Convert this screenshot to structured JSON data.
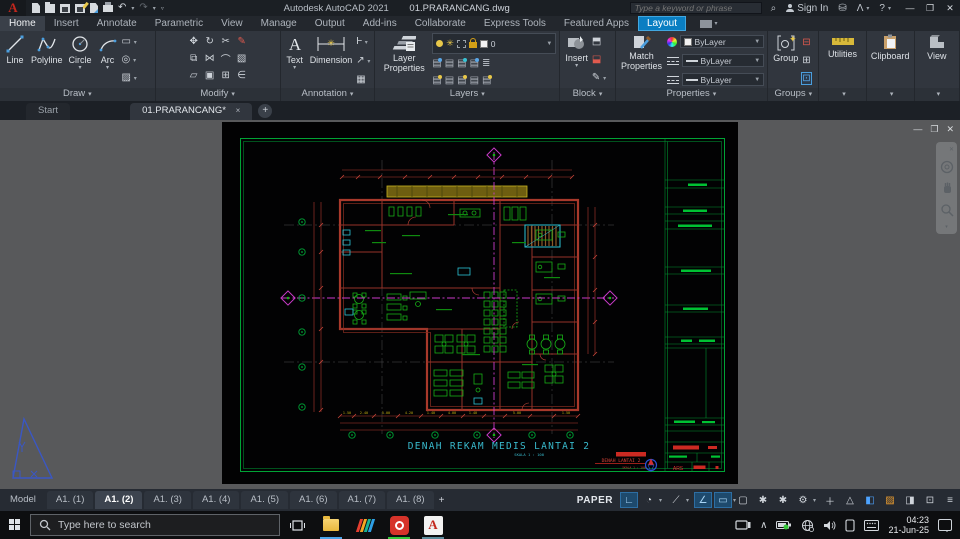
{
  "titlebar": {
    "app": "Autodesk AutoCAD 2021",
    "doc": "01.PRARANCANG.dwg",
    "search_placeholder": "Type a keyword or phrase",
    "sign_in": "Sign In"
  },
  "ribbon": {
    "tabs": [
      "Home",
      "Insert",
      "Annotate",
      "Parametric",
      "View",
      "Manage",
      "Output",
      "Add-ins",
      "Collaborate",
      "Express Tools",
      "Featured Apps",
      "Layout"
    ],
    "draw": {
      "label": "Draw",
      "line": "Line",
      "polyline": "Polyline",
      "circle": "Circle",
      "arc": "Arc"
    },
    "modify": {
      "label": "Modify"
    },
    "annotation": {
      "label": "Annotation",
      "text": "Text",
      "dimension": "Dimension"
    },
    "layers": {
      "label": "Layers",
      "layer_properties": "Layer Properties",
      "current_layer": "0"
    },
    "block": {
      "label": "Block",
      "insert": "Insert"
    },
    "properties": {
      "label": "Properties",
      "match": "Match Properties",
      "color": "ByLayer",
      "lineweight": "ByLayer",
      "linetype": "ByLayer"
    },
    "groups": {
      "label": "Groups",
      "group": "Group"
    },
    "utilities": {
      "label": "Utilities"
    },
    "clipboard": {
      "label": "Clipboard"
    },
    "view": {
      "label": "View"
    }
  },
  "file_tabs": {
    "start": "Start",
    "doc": "01.PRARANCANG*",
    "close": "×",
    "add": "+"
  },
  "drawing": {
    "title": "DENAH REKAM MEDIS LANTAI 2",
    "scale": "SKALA 1 : 100",
    "tb_title": "DENAH LANTAI 2",
    "tb_scale": "SKALA 1 : 100",
    "discipline": "ARS",
    "dims_bottom": [
      "1.50",
      "2.40",
      "5.00",
      "4.20",
      "1.40",
      "4.00",
      "1.40",
      "5.00",
      "1.50"
    ]
  },
  "layout_bar": {
    "tabs": [
      "Model",
      "A1. (1)",
      "A1. (2)",
      "A1. (3)",
      "A1. (4)",
      "A1. (5)",
      "A1. (6)",
      "A1. (7)",
      "A1. (8)"
    ],
    "add": "+",
    "space": "PAPER"
  },
  "taskbar": {
    "search_placeholder": "Type here to search",
    "time": "04:23",
    "date": "21-Jun-25"
  }
}
